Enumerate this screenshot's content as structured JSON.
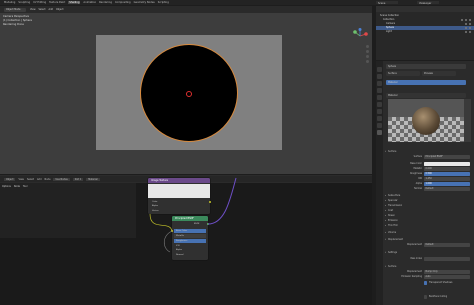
{
  "topbar": {
    "menus": [
      "Modeling",
      "Sculpting",
      "UV Editing",
      "Texture Paint",
      "Shading",
      "Animation",
      "Rendering",
      "Compositing",
      "Geometry Nodes",
      "Scripting"
    ],
    "active_menu": "Shading",
    "scene": "Scene",
    "view_layer": "ViewLayer"
  },
  "viewport": {
    "mode": "Object Mode",
    "menus": [
      "View",
      "Select",
      "Add",
      "Object"
    ],
    "info_lines": [
      "Camera Perspective",
      "(1) Collection | Sphere",
      "Rendering Done"
    ]
  },
  "outliner": {
    "rows": [
      {
        "label": "Scene Collection",
        "selected": false
      },
      {
        "label": "Collection",
        "selected": false
      },
      {
        "label": "Camera",
        "selected": false
      },
      {
        "label": "Sphere",
        "selected": true
      },
      {
        "label": "Light",
        "selected": false
      }
    ]
  },
  "properties": {
    "object_name": "Sphere",
    "material_name": "Material",
    "tab_surface": "Surface",
    "tab_preview": "Preview",
    "surface_label": "Surface",
    "surface_value": "Principled BSDF",
    "rows": [
      {
        "label": "Base Color",
        "value": ""
      },
      {
        "label": "Metallic",
        "value": "0.000"
      },
      {
        "label": "Roughness",
        "value": "0.500"
      },
      {
        "label": "IOR",
        "value": "1.450"
      },
      {
        "label": "Alpha",
        "value": "1.000"
      },
      {
        "label": "Normal",
        "value": "Default"
      }
    ],
    "sections": [
      "Subsurface",
      "Specular",
      "Transmission",
      "Coat",
      "Sheen",
      "Emission",
      "Thin Film"
    ],
    "volume_label": "Volume",
    "displacement_label": "Displacement",
    "displacement_value": "Default",
    "settings_label": "Settings",
    "pass_index_label": "Pass Index",
    "surface_sub": "Surface",
    "displacement_method_label": "Displacement",
    "displacement_method_value": "Bump Only",
    "emission_sampling_label": "Emission Sampling",
    "emission_sampling_value": "Auto",
    "transparent_shadows_label": "Transparent Shadows",
    "backface_label": "Backface Culling"
  },
  "node_editor": {
    "header_menus": [
      "Object",
      "View",
      "Select",
      "Add",
      "Node"
    ],
    "use_nodes_label": "Use Nodes",
    "slot_label": "Slot 1",
    "material_field": "Material",
    "left_panel_tabs": [
      "Options",
      "Node",
      "Tool"
    ],
    "texture_node": {
      "title": "Image Texture",
      "outputs": [
        "Color",
        "Alpha"
      ],
      "inputs": [
        "Vector"
      ]
    },
    "bsdf_node": {
      "title": "Principled BSDF",
      "rows": [
        "BSDF",
        "Base Color",
        "Metallic",
        "Roughness",
        "IOR",
        "Alpha",
        "Normal",
        "Subsurface",
        "Specular",
        "Emission"
      ]
    },
    "output_node": {
      "title": "Material Output",
      "rows": [
        "All",
        "Surface",
        "Volume",
        "Displacement"
      ]
    }
  },
  "colors": {
    "accent": "#4772b3",
    "selection_outline": "#d98a3c",
    "shader_header": "#3b8a5c",
    "texture_header": "#6b4a8a",
    "output_header": "#8a3b3b",
    "socket_yellow": "#c7c729",
    "socket_green": "#63c763",
    "socket_purple": "#6363c7",
    "wire": "#6e4fc7"
  }
}
